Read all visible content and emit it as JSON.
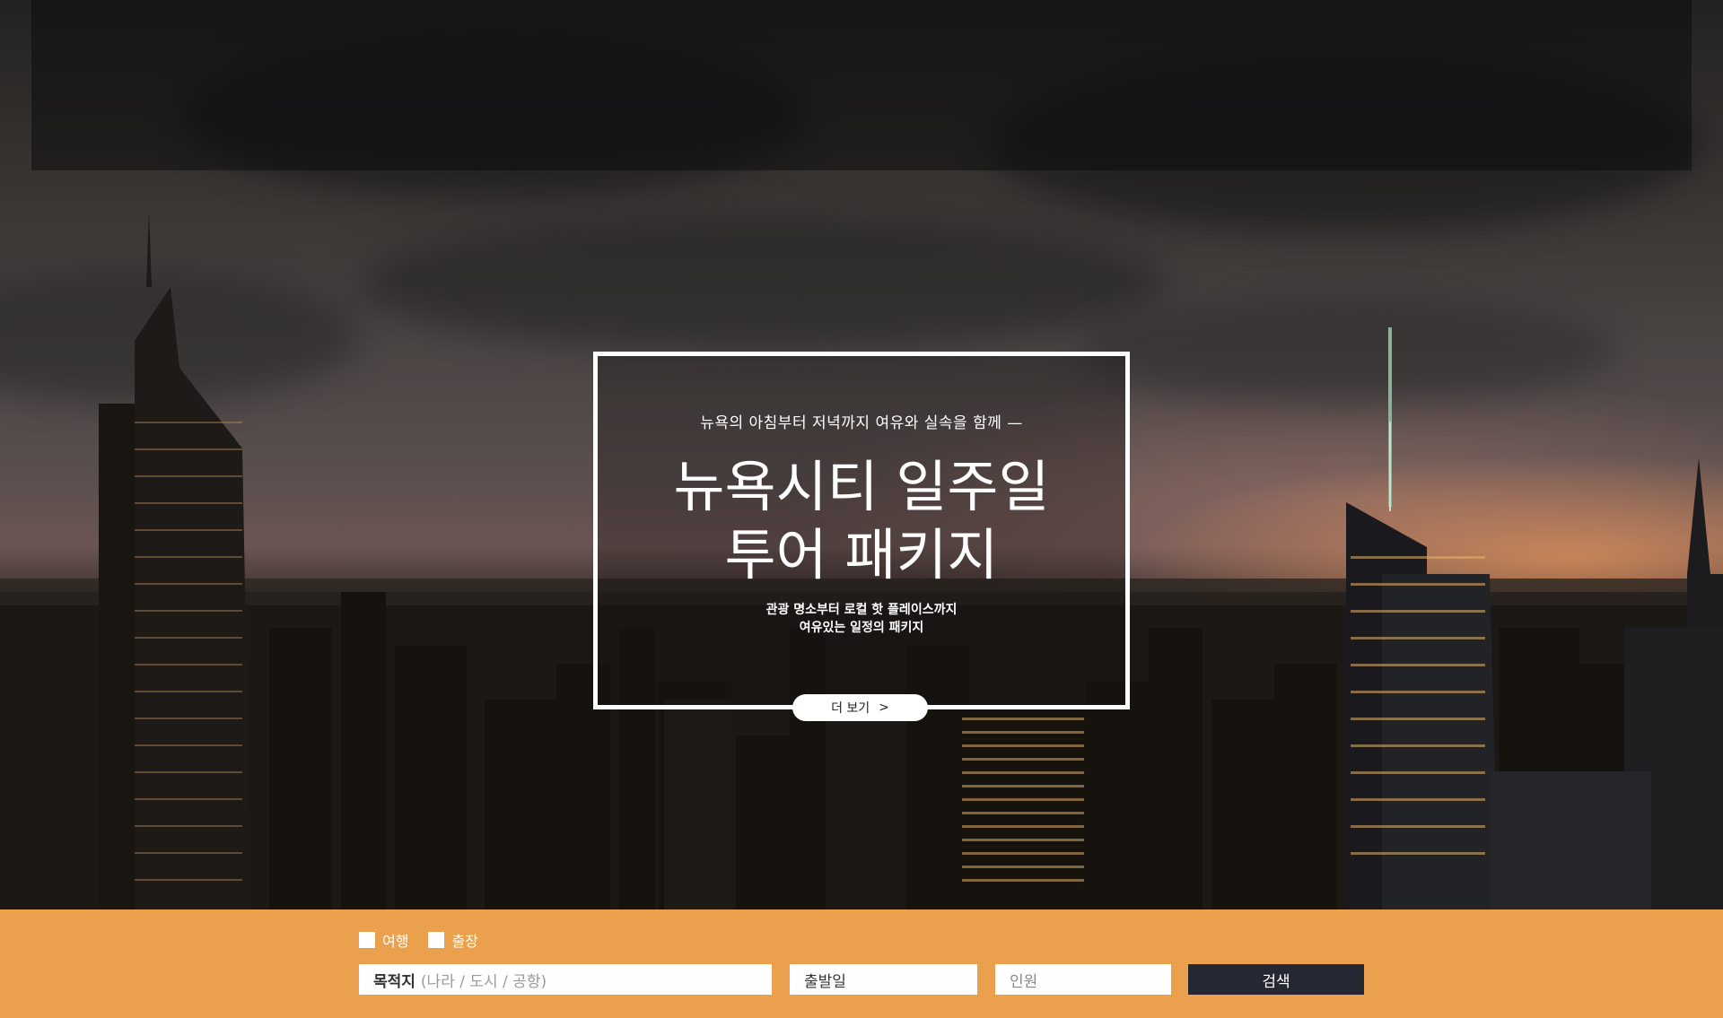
{
  "hero": {
    "subtitle": "뉴욕의 아침부터 저녁까지 여유와 실속을 함께 —",
    "title_line1": "뉴욕시티 일주일",
    "title_line2": "투어 패키지",
    "desc_line1": "관광 명소부터 로컬 핫 플레이스까지",
    "desc_line2": "여유있는 일정의 패키지",
    "more_label": "더 보기",
    "more_icon": ">"
  },
  "search": {
    "options": [
      {
        "label": "여행",
        "checked": false
      },
      {
        "label": "출장",
        "checked": false
      }
    ],
    "destination_label": "목적지",
    "destination_placeholder": "(나라 / 도시 / 공항)",
    "date_placeholder": "출발일",
    "people_placeholder": "인원",
    "search_label": "검색"
  },
  "colors": {
    "accent": "#eaa04d",
    "button_dark": "#252833"
  }
}
